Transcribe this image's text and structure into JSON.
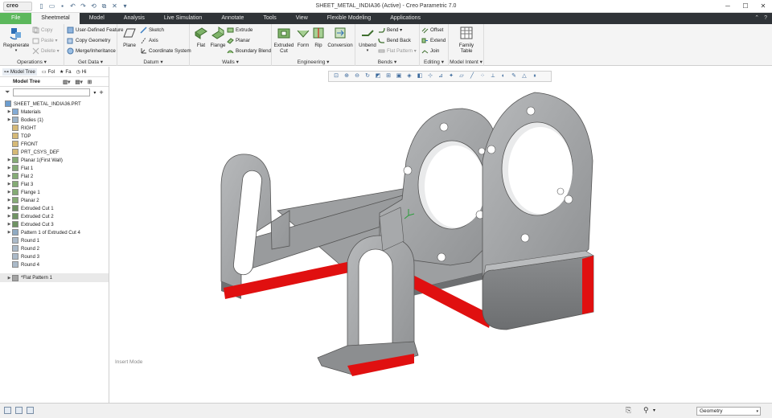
{
  "app": {
    "logo": "creo",
    "window_title": "SHEET_METAL_INDIA36 (Active) - Creo Parametric 7.0"
  },
  "tabs": [
    "File",
    "Sheetmetal",
    "Model",
    "Analysis",
    "Live Simulation",
    "Annotate",
    "Tools",
    "View",
    "Flexible Modeling",
    "Applications"
  ],
  "ribbon": {
    "operations": {
      "label": "Operations ▾",
      "regenerate": "Regenerate",
      "copy": "Copy",
      "paste": "Paste ▾",
      "delete": "Delete ▾"
    },
    "get_data": {
      "label": "Get Data ▾",
      "udf": "User-Defined Feature",
      "copy_geometry": "Copy Geometry",
      "merge": "Merge/Inheritance"
    },
    "datum": {
      "label": "Datum ▾",
      "plane": "Plane",
      "sketch": "Sketch",
      "axis": "Axis",
      "csys": "Coordinate System"
    },
    "walls": {
      "label": "Walls ▾",
      "flat": "Flat",
      "flange": "Flange",
      "extrude": "Extrude",
      "planar": "Planar",
      "boundary_blend": "Boundary Blend"
    },
    "engineering": {
      "label": "Engineering ▾",
      "extruded_cut": "Extruded Cut",
      "form": "Form",
      "rip": "Rip",
      "conversion": "Conversion"
    },
    "bends": {
      "label": "Bends ▾",
      "unbend": "Unbend",
      "bend": "Bend ▾",
      "bend_back": "Bend Back",
      "flat_pattern": "Flat Pattern ▾"
    },
    "editing": {
      "label": "Editing ▾",
      "offset": "Offset",
      "extend": "Extend",
      "join": "Join"
    },
    "model_intent": {
      "label": "Model Intent ▾",
      "family_table": "Family Table"
    }
  },
  "panel": {
    "tabs": [
      "Fol",
      "Fa",
      "Hi"
    ],
    "title": "Model Tree",
    "tree": [
      {
        "label": "SHEET_METAL_INDIA36.PRT",
        "arrow": "",
        "cls": "root"
      },
      {
        "label": "Materials",
        "arrow": "▶",
        "cls": "l1"
      },
      {
        "label": "Bodies (1)",
        "arrow": "▶",
        "cls": "l1"
      },
      {
        "label": "RIGHT",
        "arrow": "",
        "cls": "l1 noarrow"
      },
      {
        "label": "TOP",
        "arrow": "",
        "cls": "l1 noarrow"
      },
      {
        "label": "FRONT",
        "arrow": "",
        "cls": "l1 noarrow"
      },
      {
        "label": "PRT_CSYS_DEF",
        "arrow": "",
        "cls": "l1 noarrow"
      },
      {
        "label": "Planar 1(First Wall)",
        "arrow": "▶",
        "cls": "l1"
      },
      {
        "label": "Flat 1",
        "arrow": "▶",
        "cls": "l1"
      },
      {
        "label": "Flat 2",
        "arrow": "▶",
        "cls": "l1"
      },
      {
        "label": "Flat 3",
        "arrow": "▶",
        "cls": "l1"
      },
      {
        "label": "Flange 1",
        "arrow": "▶",
        "cls": "l1"
      },
      {
        "label": "Planar 2",
        "arrow": "▶",
        "cls": "l1"
      },
      {
        "label": "Extruded Cut 1",
        "arrow": "▶",
        "cls": "l1"
      },
      {
        "label": "Extruded Cut 2",
        "arrow": "▶",
        "cls": "l1"
      },
      {
        "label": "Extruded Cut 3",
        "arrow": "▶",
        "cls": "l1"
      },
      {
        "label": "Pattern 1 of Extruded Cut 4",
        "arrow": "▶",
        "cls": "l1"
      },
      {
        "label": "Round 1",
        "arrow": "",
        "cls": "l1 noarrow"
      },
      {
        "label": "Round 2",
        "arrow": "",
        "cls": "l1 noarrow"
      },
      {
        "label": "Round 3",
        "arrow": "",
        "cls": "l1 noarrow"
      },
      {
        "label": "Round 4",
        "arrow": "",
        "cls": "l1 noarrow"
      },
      {
        "label": "*Flat Pattern 1",
        "arrow": "▶",
        "cls": "l1 sep"
      }
    ]
  },
  "canvas": {
    "mode": "Insert Mode"
  },
  "status": {
    "filter": "Geometry"
  },
  "colors": {
    "highlight": "#e01010",
    "part": "#a7a9ab"
  }
}
